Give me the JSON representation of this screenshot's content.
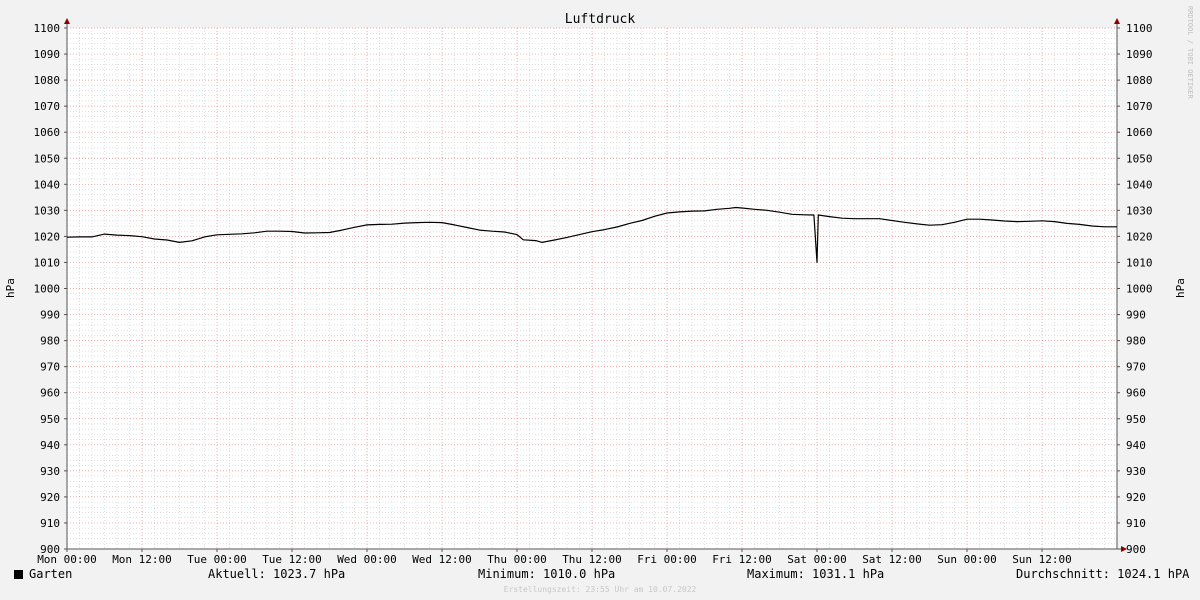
{
  "chart_data": {
    "type": "line",
    "title": "Luftdruck",
    "ylabel": "hPa",
    "ylim": [
      900,
      1100
    ],
    "y_ticks": [
      900,
      910,
      920,
      930,
      940,
      950,
      960,
      970,
      980,
      990,
      1000,
      1010,
      1020,
      1030,
      1040,
      1050,
      1060,
      1070,
      1080,
      1090,
      1100
    ],
    "x_range_hours": [
      0,
      168
    ],
    "x_ticks": [
      {
        "h": 0,
        "label": "Mon 00:00"
      },
      {
        "h": 12,
        "label": "Mon 12:00"
      },
      {
        "h": 24,
        "label": "Tue 00:00"
      },
      {
        "h": 36,
        "label": "Tue 12:00"
      },
      {
        "h": 48,
        "label": "Wed 00:00"
      },
      {
        "h": 60,
        "label": "Wed 12:00"
      },
      {
        "h": 72,
        "label": "Thu 00:00"
      },
      {
        "h": 84,
        "label": "Thu 12:00"
      },
      {
        "h": 96,
        "label": "Fri 00:00"
      },
      {
        "h": 108,
        "label": "Fri 12:00"
      },
      {
        "h": 120,
        "label": "Sat 00:00"
      },
      {
        "h": 132,
        "label": "Sat 12:00"
      },
      {
        "h": 144,
        "label": "Sun 00:00"
      },
      {
        "h": 156,
        "label": "Sun 12:00"
      }
    ],
    "grid": true,
    "series": [
      {
        "name": "Garten",
        "color": "#000000",
        "points": [
          [
            0,
            1019.7
          ],
          [
            2,
            1019.8
          ],
          [
            4,
            1019.8
          ],
          [
            6,
            1020.9
          ],
          [
            8,
            1020.5
          ],
          [
            10,
            1020.3
          ],
          [
            12,
            1019.9
          ],
          [
            14,
            1019.0
          ],
          [
            16,
            1018.6
          ],
          [
            18,
            1017.7
          ],
          [
            20,
            1018.3
          ],
          [
            22,
            1019.8
          ],
          [
            24,
            1020.6
          ],
          [
            26,
            1020.8
          ],
          [
            28,
            1021.0
          ],
          [
            30,
            1021.4
          ],
          [
            32,
            1022.0
          ],
          [
            34,
            1022.0
          ],
          [
            36,
            1021.9
          ],
          [
            38,
            1021.3
          ],
          [
            40,
            1021.4
          ],
          [
            42,
            1021.5
          ],
          [
            44,
            1022.4
          ],
          [
            46,
            1023.5
          ],
          [
            48,
            1024.4
          ],
          [
            50,
            1024.6
          ],
          [
            52,
            1024.7
          ],
          [
            54,
            1025.1
          ],
          [
            56,
            1025.3
          ],
          [
            58,
            1025.4
          ],
          [
            60,
            1025.3
          ],
          [
            62,
            1024.4
          ],
          [
            64,
            1023.4
          ],
          [
            66,
            1022.4
          ],
          [
            68,
            1022.0
          ],
          [
            70,
            1021.7
          ],
          [
            72,
            1020.7
          ],
          [
            73,
            1018.7
          ],
          [
            75,
            1018.4
          ],
          [
            76,
            1017.7
          ],
          [
            78,
            1018.6
          ],
          [
            80,
            1019.6
          ],
          [
            82,
            1020.7
          ],
          [
            84,
            1021.8
          ],
          [
            86,
            1022.6
          ],
          [
            88,
            1023.6
          ],
          [
            90,
            1025.0
          ],
          [
            92,
            1026.1
          ],
          [
            94,
            1027.7
          ],
          [
            96,
            1029.0
          ],
          [
            98,
            1029.4
          ],
          [
            100,
            1029.7
          ],
          [
            102,
            1029.8
          ],
          [
            104,
            1030.4
          ],
          [
            106,
            1030.8
          ],
          [
            107,
            1031.1
          ],
          [
            108,
            1030.9
          ],
          [
            110,
            1030.4
          ],
          [
            112,
            1030.0
          ],
          [
            114,
            1029.3
          ],
          [
            116,
            1028.5
          ],
          [
            118,
            1028.3
          ],
          [
            119.5,
            1028.2
          ],
          [
            120,
            1010.0
          ],
          [
            120.2,
            1028.2
          ],
          [
            122,
            1027.6
          ],
          [
            124,
            1027.0
          ],
          [
            126,
            1026.8
          ],
          [
            128,
            1026.8
          ],
          [
            130,
            1026.8
          ],
          [
            132,
            1026.1
          ],
          [
            134,
            1025.4
          ],
          [
            136,
            1024.8
          ],
          [
            138,
            1024.3
          ],
          [
            140,
            1024.5
          ],
          [
            142,
            1025.4
          ],
          [
            144,
            1026.6
          ],
          [
            146,
            1026.6
          ],
          [
            148,
            1026.3
          ],
          [
            150,
            1025.9
          ],
          [
            152,
            1025.7
          ],
          [
            154,
            1025.8
          ],
          [
            156,
            1026.0
          ],
          [
            158,
            1025.7
          ],
          [
            160,
            1025.0
          ],
          [
            162,
            1024.6
          ],
          [
            164,
            1024.0
          ],
          [
            166,
            1023.7
          ],
          [
            168,
            1023.7
          ]
        ]
      }
    ]
  },
  "legend": {
    "series_name": "Garten",
    "swatch_color": "#000000",
    "current": "Aktuell: 1023.7 hPa",
    "minimum": "Minimum: 1010.0 hPa",
    "maximum": "Maximum: 1031.1 hPa",
    "average": "Durchschnitt: 1024.1 hPA"
  },
  "watermark": "RRDTOOL / TOBI OETIKER",
  "footer": "Erstellungszeit: 23:55 Uhr am 10.07.2022",
  "colors": {
    "background": "#f2f2f2",
    "canvas": "#ffffff",
    "grid_minor": "#cccccc",
    "grid_major": "#e88e8e",
    "axis": "#555555",
    "arrow": "#8b0000",
    "line": "#000000"
  }
}
